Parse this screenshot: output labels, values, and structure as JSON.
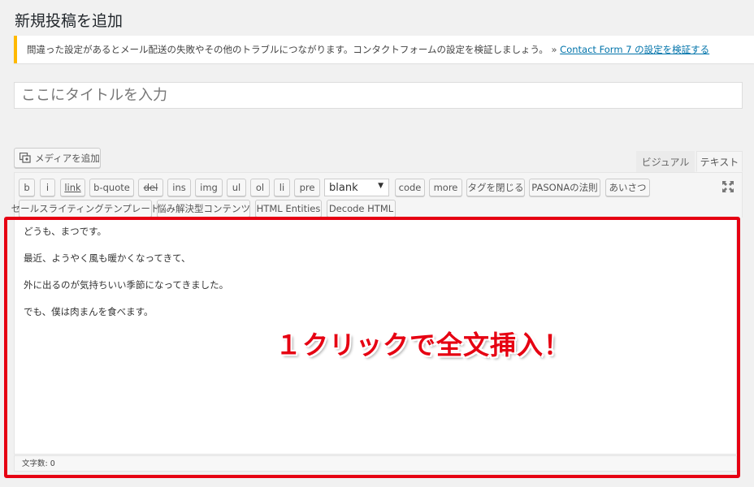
{
  "page": {
    "title": "新規投稿を追加"
  },
  "notice": {
    "message": "間違った設定があるとメール配送の失敗やその他のトラブルにつながります。コンタクトフォームの設定を検証しましょう。",
    "separator": "»",
    "link_label": "Contact Form 7 の設定を検証する"
  },
  "title_field": {
    "placeholder": "ここにタイトルを入力",
    "value": ""
  },
  "media_button": {
    "label": "メディアを追加",
    "icon": "add-media-icon"
  },
  "tabs": {
    "visual": "ビジュアル",
    "text": "テキスト",
    "active": "text"
  },
  "quicktags": {
    "b": "b",
    "i": "i",
    "link": "link",
    "bquote": "b-quote",
    "del": "del",
    "ins": "ins",
    "img": "img",
    "ul": "ul",
    "ol": "ol",
    "li": "li",
    "pre": "pre",
    "select_value": "blank",
    "code": "code",
    "more": "more",
    "close_tags": "タグを閉じる",
    "pasona": "PASONAの法則",
    "greeting": "あいさつ",
    "sales_template": "セールスライティングテンプレート",
    "trouble_content": "悩み解決型コンテンツ",
    "html_entities": "HTML Entities",
    "decode_html": "Decode HTML"
  },
  "editor": {
    "lines": [
      "どうも、まつです。",
      "最近、ようやく風も暖かくなってきて、",
      "外に出るのが気持ちいい季節になってきました。",
      "でも、僕は肉まんを食べます。"
    ]
  },
  "status": {
    "word_count": "文字数: 0"
  },
  "annotation": {
    "text": "１クリックで全文挿入！",
    "color": "#e60012"
  },
  "colors": {
    "notice_accent": "#ffb900",
    "link": "#0073aa",
    "highlight": "#e60012"
  }
}
